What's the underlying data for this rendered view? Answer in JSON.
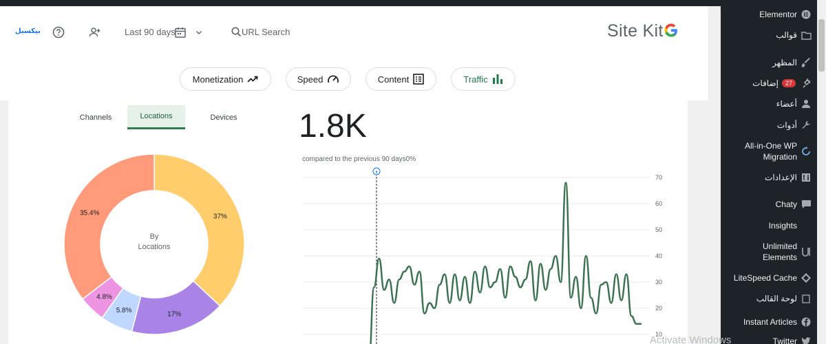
{
  "header": {
    "logo_text": "بيكسيل",
    "date_range": "Last 90 days",
    "search_placeholder": "URL Search",
    "brand": "Site Kit"
  },
  "tabs": [
    {
      "label": "Monetization",
      "icon": "trend-up-icon"
    },
    {
      "label": "Speed",
      "icon": "speedometer-icon"
    },
    {
      "label": "Content",
      "icon": "list-icon"
    },
    {
      "label": "Traffic",
      "icon": "bar-chart-icon",
      "active": true
    }
  ],
  "subtabs": [
    {
      "label": "Channels"
    },
    {
      "label": "Locations",
      "active": true
    },
    {
      "label": "Devices"
    }
  ],
  "metric": {
    "value": "1.8K",
    "compare_text": "compared to the previous 90 days0%"
  },
  "chart_data": [
    {
      "type": "pie",
      "title": "",
      "center_label_line1": "By",
      "center_label_line2": "Locations",
      "categories": [
        "",
        "",
        "",
        "",
        ""
      ],
      "values": [
        37,
        17,
        5.8,
        4.8,
        35.4
      ],
      "labels": [
        "37%",
        "17%",
        "5.8%",
        "4.8%",
        "35.4%"
      ],
      "colors": [
        "#ffcd6c",
        "#a983e6",
        "#c0d8ff",
        "#ed94e2",
        "#ff9b7a"
      ]
    },
    {
      "type": "line",
      "title": "",
      "ylim": [
        10,
        70
      ],
      "yticks": [
        "70",
        "60",
        "50",
        "40",
        "30",
        "20",
        "10"
      ],
      "grid": true,
      "axis_side": "right",
      "color": "#3c7251",
      "y": [
        0,
        28,
        39,
        27,
        31,
        22,
        31,
        34,
        36,
        29,
        34,
        18,
        22,
        20,
        29,
        33,
        22,
        33,
        23,
        32,
        22,
        34,
        26,
        36,
        28,
        30,
        35,
        24,
        36,
        32,
        28,
        31,
        38,
        23,
        37,
        27,
        35,
        40,
        30,
        68,
        24,
        32,
        20,
        40,
        24,
        18,
        29,
        30,
        22,
        33,
        23,
        33,
        17,
        14,
        14
      ]
    }
  ],
  "sidebar": {
    "items": [
      {
        "label": "Elementor",
        "icon": "elementor-icon"
      },
      {
        "label": "قوالب",
        "icon": "folder-icon"
      },
      {
        "label": "المظهر",
        "icon": "paintbrush-icon"
      },
      {
        "label": "إضافات",
        "icon": "plugin-icon",
        "badge": "27"
      },
      {
        "label": "أعضاء",
        "icon": "user-icon"
      },
      {
        "label": "أدوات",
        "icon": "wrench-icon"
      },
      {
        "label": "All-in-One WP Migration",
        "icon": "migration-icon"
      },
      {
        "label": "الإعدادات",
        "icon": "settings-icon"
      },
      {
        "label": "Chaty",
        "icon": "chat-icon"
      },
      {
        "label": "Insights",
        "icon": ""
      },
      {
        "label": "Unlimited Elements",
        "icon": "elements-icon"
      },
      {
        "label": "LiteSpeed Cache",
        "icon": "diamond-icon"
      },
      {
        "label": "لوحة القالب",
        "icon": "panel-icon"
      },
      {
        "label": "Instant Articles",
        "icon": "facebook-icon"
      },
      {
        "label": "Twitter",
        "icon": "twitter-icon"
      }
    ]
  },
  "watermark": "Activate Windows",
  "colors": {
    "accent": "#2e7d4f",
    "sidebar_bg": "#1d2327",
    "line": "#3c7251"
  }
}
